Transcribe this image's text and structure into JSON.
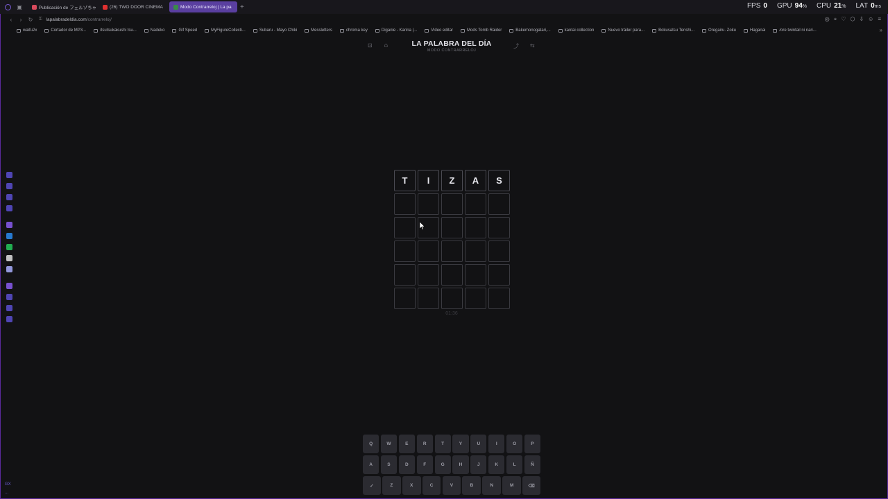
{
  "browser": {
    "tabs": [
      {
        "label": "Publicación de フェルゾちゃん",
        "favicon_color": "#d84a5c",
        "active": false
      },
      {
        "label": "(26) TWO DOOR CINEMA",
        "favicon_color": "#e03030",
        "active": false
      },
      {
        "label": "Modo Contrarreloj | La pa",
        "favicon_color": "#3a8a4a",
        "active": true
      }
    ],
    "new_tab": "+",
    "url_domain": "lapalabradeldia.com",
    "url_path": "/contrarreloj/",
    "metrics": [
      {
        "label": "FPS",
        "value": "0",
        "unit": ""
      },
      {
        "label": "GPU",
        "value": "94",
        "unit": "%"
      },
      {
        "label": "CPU",
        "value": "21",
        "unit": "%"
      },
      {
        "label": "LAT",
        "value": "0",
        "unit": "ms"
      }
    ],
    "bookmarks": [
      "waifu2x",
      "Cortador de MP3...",
      "/tsutsukakushi tsu...",
      "Nadeko",
      "Gif Speed",
      "MyFigureCollecti...",
      "Subaru - Mayo Chiki",
      "Messletters",
      "chroma key",
      "Diganle - Karina |...",
      "Video editar",
      "Mods Tomb Raider",
      "Bakemonogatari,...",
      "kantai collection",
      "Nuevo tráiler para...",
      "Bokusatsu Tenshi...",
      "Oregairu. Zoku",
      "Haganai",
      "/ore twintail ni nari..."
    ],
    "accent": "#5b2a9c"
  },
  "sidebar": {
    "icons": [
      {
        "name": "recent-icon",
        "color": "#5a4fd0"
      },
      {
        "name": "ai-icon",
        "color": "#5a4fd0"
      },
      {
        "name": "wallet-icon",
        "color": "#5a4fd0"
      },
      {
        "name": "pinboard-icon",
        "color": "#5a4fd0"
      },
      {
        "name": "twitch-icon",
        "color": "#8a5cf0"
      },
      {
        "name": "messenger-icon",
        "color": "#2a8cf0"
      },
      {
        "name": "whatsapp-icon",
        "color": "#25c95a"
      },
      {
        "name": "x-icon",
        "color": "#e0e0e0"
      },
      {
        "name": "discord-icon",
        "color": "#aab0ff"
      },
      {
        "name": "notes-icon",
        "color": "#8a5cf0"
      },
      {
        "name": "history-icon",
        "color": "#5a4fd0"
      },
      {
        "name": "bookmarks-icon",
        "color": "#5a4fd0"
      },
      {
        "name": "settings-icon",
        "color": "#5a4fd0"
      }
    ],
    "bottom": [
      "GX",
      "..."
    ]
  },
  "game": {
    "title": "LA PALABRA DEL DÍA",
    "subtitle": "MODO CONTRARRELOJ",
    "grid": [
      [
        "T",
        "I",
        "Z",
        "A",
        "S"
      ],
      [
        "",
        "",
        "",
        "",
        ""
      ],
      [
        "",
        "",
        "",
        "",
        ""
      ],
      [
        "",
        "",
        "",
        "",
        ""
      ],
      [
        "",
        "",
        "",
        "",
        ""
      ],
      [
        "",
        "",
        "",
        "",
        ""
      ]
    ],
    "timer": "01:36",
    "keyboard": [
      [
        "Q",
        "W",
        "E",
        "R",
        "T",
        "Y",
        "U",
        "I",
        "O",
        "P"
      ],
      [
        "A",
        "S",
        "D",
        "F",
        "G",
        "H",
        "J",
        "K",
        "L",
        "Ñ"
      ],
      [
        "✓",
        "Z",
        "X",
        "C",
        "V",
        "B",
        "N",
        "M",
        "⌫"
      ]
    ]
  }
}
